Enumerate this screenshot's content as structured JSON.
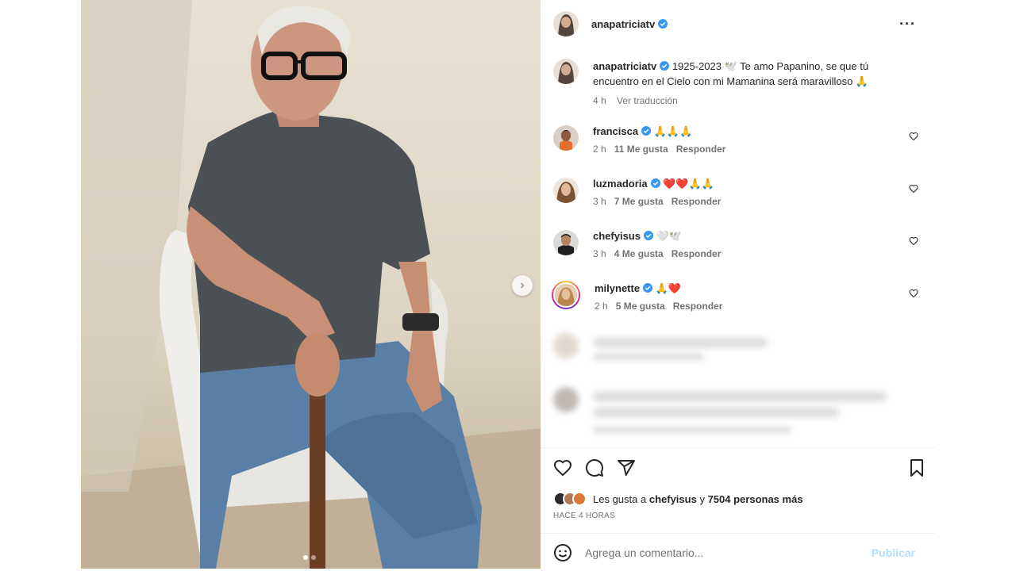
{
  "post": {
    "author": "anapatriciatv",
    "verified": true,
    "more_icon": "more-horizontal-icon",
    "caption_text": "1925-2023 🕊️ Te amo Papanino, se que tú encuentro en el Cielo con mi Mamanina será maravilloso 🙏",
    "caption_time": "4 h",
    "translate_label": "Ver traducción"
  },
  "comments": [
    {
      "user": "francisca",
      "verified": true,
      "text": "🙏🙏🙏",
      "time": "2 h",
      "likes": "11 Me gusta",
      "reply": "Responder"
    },
    {
      "user": "luzmadoria",
      "verified": true,
      "text": "❤️❤️🙏🙏",
      "time": "3 h",
      "likes": "7 Me gusta",
      "reply": "Responder"
    },
    {
      "user": "chefyisus",
      "verified": true,
      "text": "🤍🕊️",
      "time": "3 h",
      "likes": "4 Me gusta",
      "reply": "Responder"
    },
    {
      "user": "milynette",
      "verified": true,
      "text": "🙏❤️",
      "time": "2 h",
      "likes": "5 Me gusta",
      "reply": "Responder"
    }
  ],
  "likes": {
    "prefix": "Les gusta a ",
    "user": "chefyisus",
    "middle": " y ",
    "count": "7504 personas más"
  },
  "time_ago": "HACE 4 HORAS",
  "composer": {
    "placeholder": "Agrega un comentario...",
    "publish": "Publicar"
  },
  "carousel": {
    "slides": 2,
    "current": 1
  },
  "colors": {
    "verified": "#3897f0",
    "link_disabled": "#b2dffc",
    "muted": "#737373"
  }
}
